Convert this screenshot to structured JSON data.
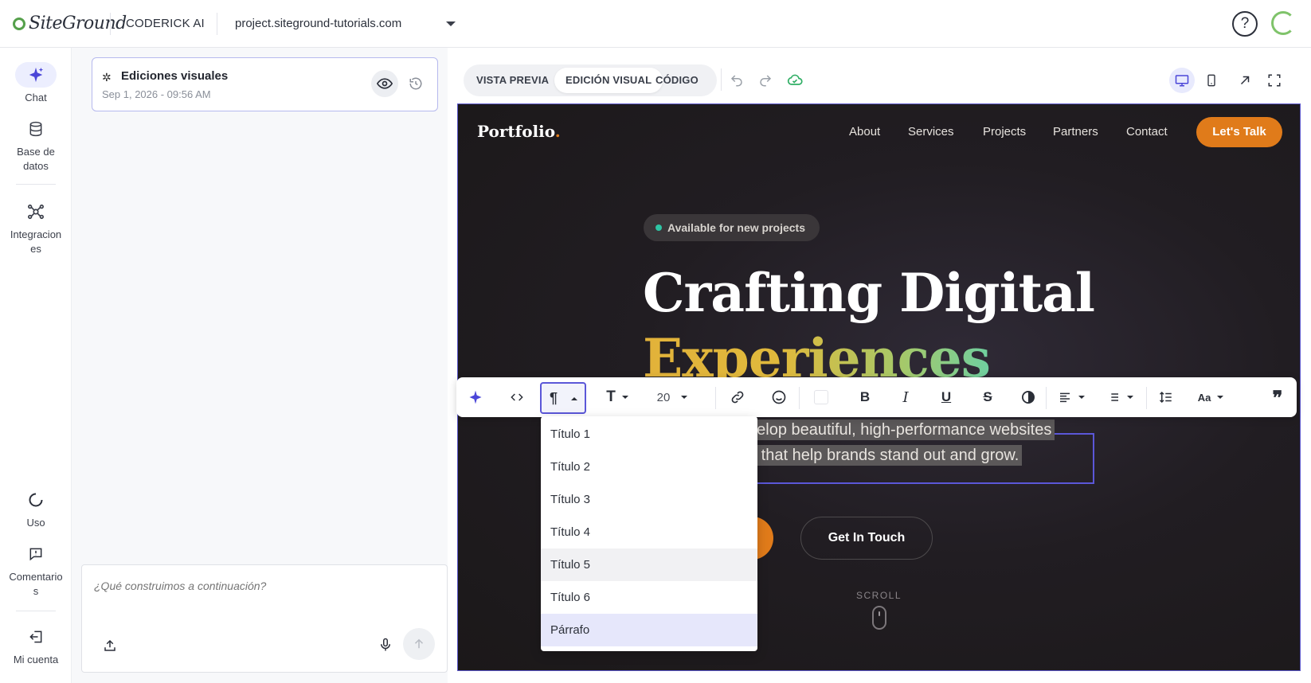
{
  "topbar": {
    "logo_text": "SiteGround",
    "product": "CODERICK AI",
    "domain": "project.siteground-tutorials.com",
    "help_label": "?"
  },
  "leftnav": {
    "items": [
      {
        "label": "Chat",
        "icon": "sparkle-icon"
      },
      {
        "label": "Base de datos",
        "icon": "database-icon"
      },
      {
        "label": "Integraciones",
        "icon": "integrations-icon"
      },
      {
        "label": "Uso",
        "icon": "usage-icon"
      },
      {
        "label": "Comentarios",
        "icon": "feedback-icon"
      },
      {
        "label": "Mi cuenta",
        "icon": "account-icon"
      }
    ]
  },
  "chat": {
    "edit_card": {
      "title": "Ediciones visuales",
      "timestamp": "Sep 1, 2026 - 09:56 AM"
    },
    "composer_placeholder": "¿Qué construimos a continuación?"
  },
  "editor": {
    "tabs": [
      {
        "label": "VISTA PREVIA",
        "active": false
      },
      {
        "label": "EDICIÓN VISUAL",
        "active": true
      },
      {
        "label": "CÓDIGO",
        "active": false
      }
    ],
    "active_device": "desktop"
  },
  "site": {
    "logo": "Portfolio",
    "logo_dot": ".",
    "nav": [
      "About",
      "Services",
      "Projects",
      "Partners",
      "Contact"
    ],
    "cta": "Let's Talk",
    "badge": "Available for new projects",
    "title_line1": "Crafting Digital",
    "title_line2": "Experiences",
    "para_line1": "evelop beautiful, high-performance websites",
    "para_line2": "ns that help brands stand out and grow.",
    "primary_btn_fragment": "k",
    "secondary_btn": "Get In Touch",
    "scroll_label": "SCROLL"
  },
  "format_toolbar": {
    "font_size": "20"
  },
  "block_dropdown": {
    "options": [
      "Título 1",
      "Título 2",
      "Título 3",
      "Título 4",
      "Título 5",
      "Título 6",
      "Párrafo"
    ],
    "hovered": "Título 5",
    "selected": "Párrafo"
  },
  "colors": {
    "accent": "#5b57d8",
    "brand_orange": "#e07b1a",
    "siteground_green": "#55a04b"
  }
}
